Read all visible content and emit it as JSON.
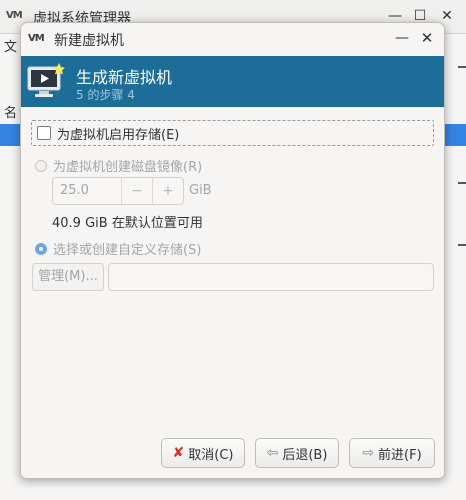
{
  "main_window": {
    "logo": "VM",
    "title": "虚拟系统管理器",
    "menu_first": "文",
    "list_header_first": "名"
  },
  "dialog": {
    "logo": "VM",
    "title": "新建虚拟机",
    "banner": {
      "title": "生成新虚拟机",
      "step": "5 的步骤 4"
    },
    "enable_storage": {
      "label": "为虚拟机启用存储(E)",
      "checked": false
    },
    "create_disk": {
      "label": "为虚拟机创建磁盘镜像(R)",
      "size_value": "25.0",
      "decrement": "−",
      "increment": "+",
      "unit": "GiB",
      "available_text": "40.9 GiB 在默认位置可用"
    },
    "custom_storage": {
      "label": "选择或创建自定义存储(S)",
      "manage_button": "管理(M)...",
      "path_value": ""
    },
    "buttons": {
      "cancel": "取消(C)",
      "back": "后退(B)",
      "forward": "前进(F)"
    }
  }
}
